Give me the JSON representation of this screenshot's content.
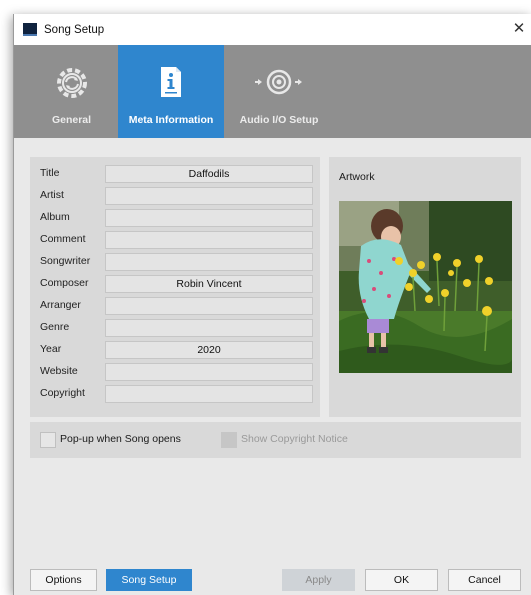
{
  "window": {
    "title": "Song Setup",
    "close_glyph": "✕"
  },
  "tabs": [
    {
      "label": "General",
      "icon": "gear-icon"
    },
    {
      "label": "Meta Information",
      "icon": "info-document-icon",
      "selected": true
    },
    {
      "label": "Audio I/O Setup",
      "icon": "speaker-io-icon"
    }
  ],
  "fields": [
    {
      "label": "Title",
      "value": "Daffodils"
    },
    {
      "label": "Artist",
      "value": ""
    },
    {
      "label": "Album",
      "value": ""
    },
    {
      "label": "Comment",
      "value": ""
    },
    {
      "label": "Songwriter",
      "value": ""
    },
    {
      "label": "Composer",
      "value": "Robin Vincent"
    },
    {
      "label": "Arranger",
      "value": ""
    },
    {
      "label": "Genre",
      "value": ""
    },
    {
      "label": "Year",
      "value": "2020"
    },
    {
      "label": "Website",
      "value": ""
    },
    {
      "label": "Copyright",
      "value": ""
    }
  ],
  "artwork": {
    "label": "Artwork"
  },
  "options": {
    "popup_label": "Pop-up when Song opens",
    "copyright_notice_label": "Show Copyright Notice"
  },
  "buttons": {
    "options": "Options",
    "song_setup": "Song Setup",
    "apply": "Apply",
    "ok": "OK",
    "cancel": "Cancel"
  },
  "colors": {
    "accent": "#2f86ce",
    "tabbar": "#8f8f8f",
    "panel": "#d9d9d9"
  }
}
